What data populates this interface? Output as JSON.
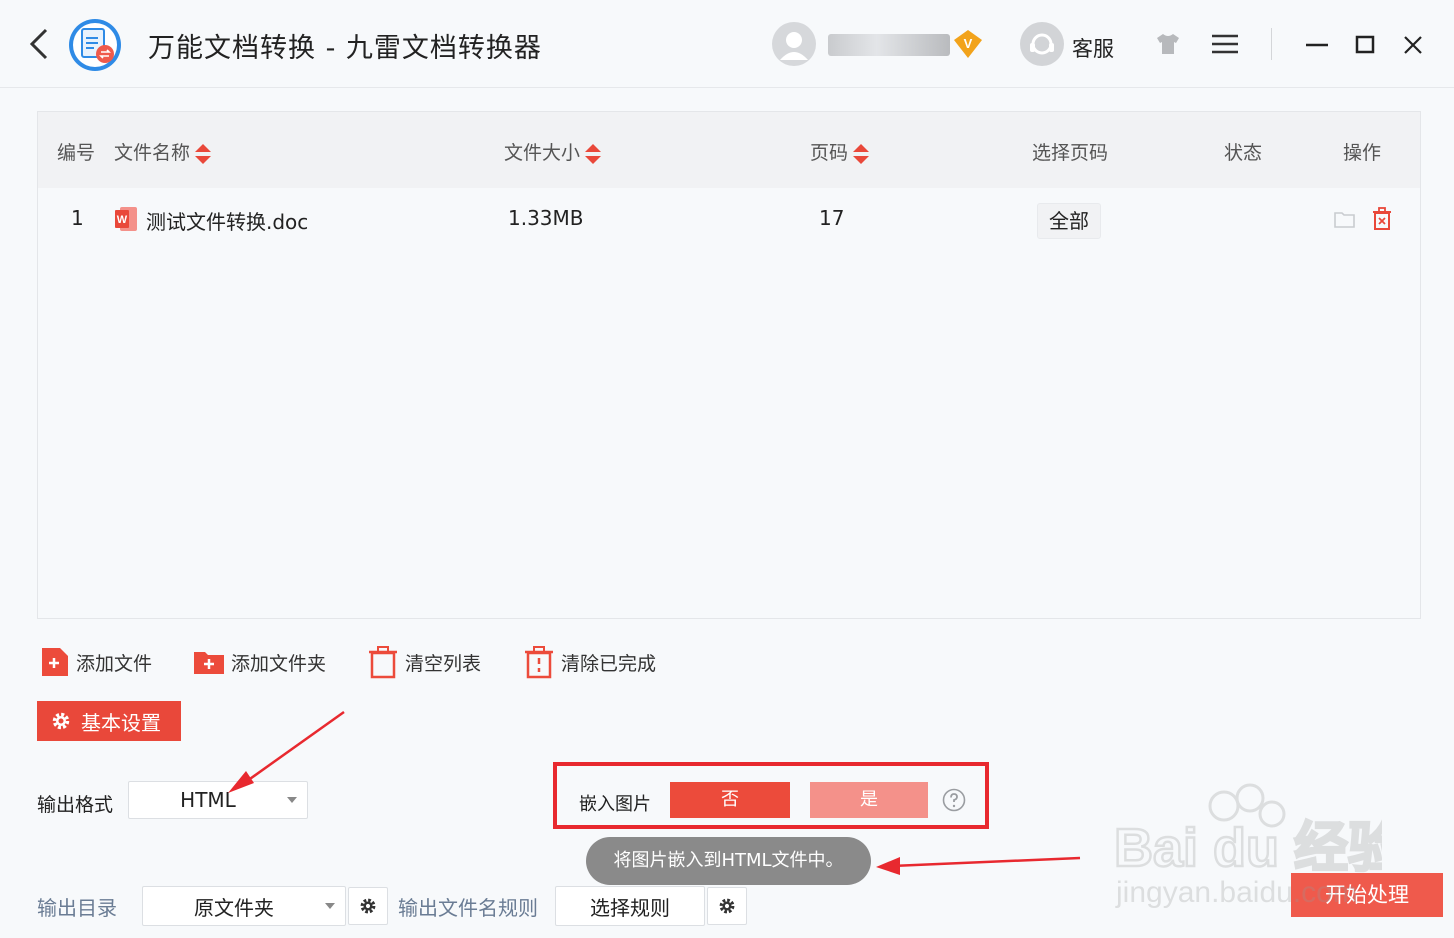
{
  "titlebar": {
    "app_title": "万能文档转换 - 九雷文档转换器",
    "vip_badge": "V",
    "customer_service": "客服"
  },
  "table": {
    "headers": {
      "index": "编号",
      "filename": "文件名称",
      "filesize": "文件大小",
      "pages": "页码",
      "select_pages": "选择页码",
      "status": "状态",
      "actions": "操作"
    },
    "rows": [
      {
        "index": "1",
        "filename": "测试文件转换.doc",
        "filesize": "1.33MB",
        "pages": "17",
        "select_pages": "全部",
        "status": ""
      }
    ]
  },
  "toolbar": {
    "add_file": "添加文件",
    "add_folder": "添加文件夹",
    "clear_list": "清空列表",
    "clear_done": "清除已完成"
  },
  "settings": {
    "basic_settings": "基本设置",
    "output_format_label": "输出格式",
    "output_format_value": "HTML",
    "embed_images_label": "嵌入图片",
    "embed_no": "否",
    "embed_yes": "是",
    "tooltip": "将图片嵌入到HTML文件中。",
    "output_dir_label": "输出目录",
    "output_dir_value": "原文件夹",
    "filename_rule_label": "输出文件名规则",
    "filename_rule_value": "选择规则",
    "start_button": "开始处理"
  },
  "watermark": {
    "brand": "Bai du 经验",
    "url": "jingyan.baidu.com"
  },
  "colors": {
    "accent": "#e9483a",
    "toggle_inactive": "#f4918a",
    "annotation": "#e8292f"
  }
}
